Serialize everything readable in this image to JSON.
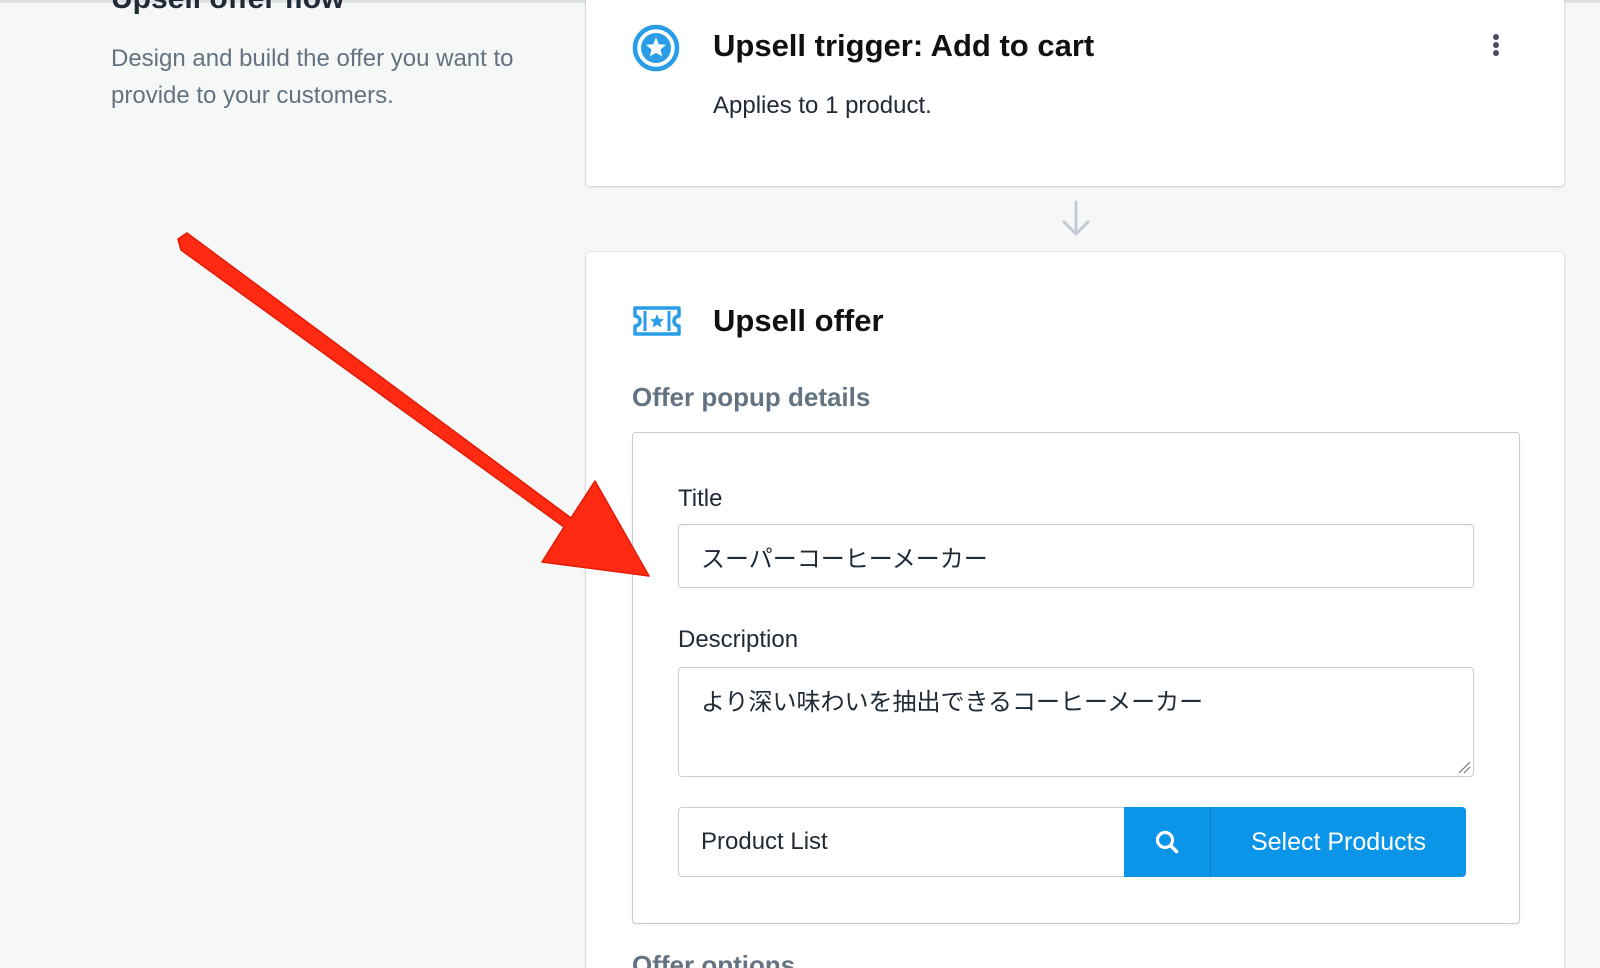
{
  "section": {
    "heading": "Upsell offer flow",
    "description": "Design and build the offer you want to provide to your customers."
  },
  "trigger_card": {
    "title": "Upsell trigger: Add to cart",
    "subtitle": "Applies to 1 product.",
    "icon": "star-circle-icon",
    "menu_icon": "more-vertical-icon"
  },
  "offer_card": {
    "icon": "ticket-icon",
    "title": "Upsell offer",
    "popup_section_title": "Offer popup details",
    "title_field": {
      "label": "Title",
      "value": "スーパーコーヒーメーカー"
    },
    "description_field": {
      "label": "Description",
      "value": "より深い味わいを抽出できるコーヒーメーカー"
    },
    "product_list": {
      "value": "Product List",
      "search_icon": "search-icon",
      "button_label": "Select Products"
    },
    "next_section_title": "Offer options"
  },
  "colors": {
    "accent": "#0b95e8",
    "icon_blue": "#2a9de8",
    "annotation_arrow": "#ff2a12"
  }
}
